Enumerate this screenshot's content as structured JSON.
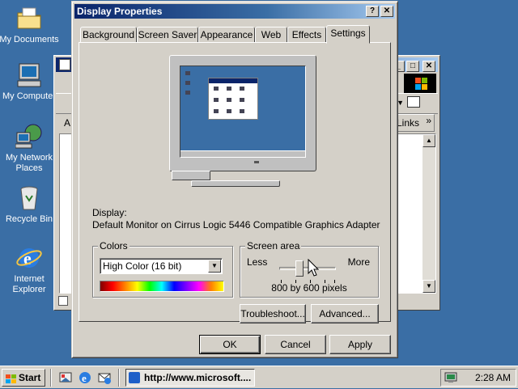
{
  "desktop": {
    "icons": [
      {
        "label": "My Documents"
      },
      {
        "label": "My Computer"
      },
      {
        "label_line1": "My Network",
        "label_line2": "Places"
      },
      {
        "label": "Recycle Bin"
      },
      {
        "label_line1": "Internet",
        "label_line2": "Explorer"
      }
    ]
  },
  "background_window": {
    "links_label": "Links",
    "links_chevron": "»",
    "address_fragment": "A",
    "ctrl_min": "_",
    "ctrl_max": "□",
    "ctrl_close": "✕"
  },
  "dialog": {
    "title": "Display Properties",
    "help_btn": "?",
    "close_btn": "✕",
    "tabs": [
      "Background",
      "Screen Saver",
      "Appearance",
      "Web",
      "Effects",
      "Settings"
    ],
    "active_tab": "Settings",
    "display_label": "Display:",
    "display_value": "Default Monitor on Cirrus Logic 5446 Compatible Graphics Adapter",
    "colors": {
      "group_label": "Colors",
      "selected": "High Color (16 bit)"
    },
    "screen_area": {
      "group_label": "Screen area",
      "less": "Less",
      "more": "More",
      "value_text": "800 by 600 pixels",
      "slider_position_fraction": 0.35
    },
    "troubleshoot_btn": "Troubleshoot...",
    "advanced_btn": "Advanced...",
    "ok_btn": "OK",
    "cancel_btn": "Cancel",
    "apply_btn": "Apply"
  },
  "taskbar": {
    "start_label": "Start",
    "task_button_label": "http://www.microsoft....",
    "clock": "2:28 AM"
  },
  "colors": {
    "desktop": "#3a6ea5",
    "title_active": "#0a246a",
    "face": "#d4d0c8"
  }
}
